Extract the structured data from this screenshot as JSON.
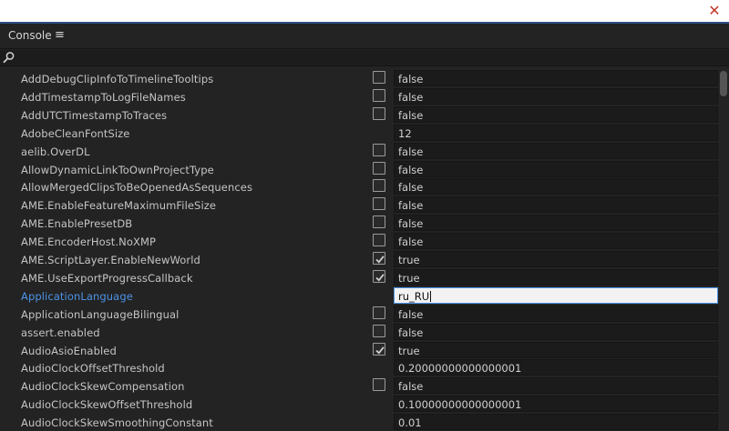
{
  "window": {
    "close_glyph": "✕"
  },
  "panel": {
    "title": "Console",
    "menu_glyph": "≡"
  },
  "search": {
    "value": "",
    "icon": "search-icon"
  },
  "colors": {
    "accent": "#2d4f87",
    "selected_key": "#4d93e6",
    "edit_bg": "#f2f2f2"
  },
  "rows": [
    {
      "key": "AddDebugClipInfoToTimelineTooltips",
      "checkbox": true,
      "checked": false,
      "value": "false"
    },
    {
      "key": "AddTimestampToLogFileNames",
      "checkbox": true,
      "checked": false,
      "value": "false"
    },
    {
      "key": "AddUTCTimestampToTraces",
      "checkbox": true,
      "checked": false,
      "value": "false"
    },
    {
      "key": "AdobeCleanFontSize",
      "checkbox": false,
      "checked": false,
      "value": "12"
    },
    {
      "key": "aelib.OverDL",
      "checkbox": true,
      "checked": false,
      "value": "false"
    },
    {
      "key": "AllowDynamicLinkToOwnProjectType",
      "checkbox": true,
      "checked": false,
      "value": "false"
    },
    {
      "key": "AllowMergedClipsToBeOpenedAsSequences",
      "checkbox": true,
      "checked": false,
      "value": "false"
    },
    {
      "key": "AME.EnableFeatureMaximumFileSize",
      "checkbox": true,
      "checked": false,
      "value": "false"
    },
    {
      "key": "AME.EnablePresetDB",
      "checkbox": true,
      "checked": false,
      "value": "false"
    },
    {
      "key": "AME.EncoderHost.NoXMP",
      "checkbox": true,
      "checked": false,
      "value": "false"
    },
    {
      "key": "AME.ScriptLayer.EnableNewWorld",
      "checkbox": true,
      "checked": true,
      "value": "true"
    },
    {
      "key": "AME.UseExportProgressCallback",
      "checkbox": true,
      "checked": true,
      "value": "true"
    },
    {
      "key": "ApplicationLanguage",
      "checkbox": false,
      "checked": false,
      "value": "ru_RU",
      "selected": true,
      "editing": true
    },
    {
      "key": "ApplicationLanguageBilingual",
      "checkbox": true,
      "checked": false,
      "value": "false"
    },
    {
      "key": "assert.enabled",
      "checkbox": true,
      "checked": false,
      "value": "false"
    },
    {
      "key": "AudioAsioEnabled",
      "checkbox": true,
      "checked": true,
      "value": "true"
    },
    {
      "key": "AudioClockOffsetThreshold",
      "checkbox": false,
      "checked": false,
      "value": "0.20000000000000001"
    },
    {
      "key": "AudioClockSkewCompensation",
      "checkbox": true,
      "checked": false,
      "value": "false"
    },
    {
      "key": "AudioClockSkewOffsetThreshold",
      "checkbox": false,
      "checked": false,
      "value": "0.10000000000000001"
    },
    {
      "key": "AudioClockSkewSmoothingConstant",
      "checkbox": false,
      "checked": false,
      "value": "0.01"
    }
  ]
}
